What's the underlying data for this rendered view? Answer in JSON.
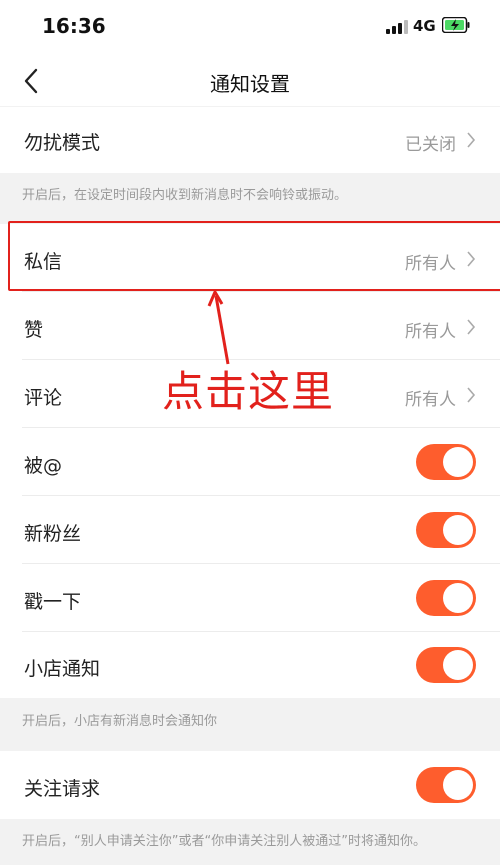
{
  "status_bar": {
    "time": "16:36",
    "network": "4G",
    "icons": [
      "signal-icon",
      "battery-charging-icon"
    ]
  },
  "nav": {
    "title": "通知设置",
    "back_icon": "back-arrow-icon"
  },
  "rows": {
    "dnd": {
      "label": "勿扰模式",
      "value": "已关闭"
    },
    "dnd_hint": "开启后，在设定时间段内收到新消息时不会响铃或振动。",
    "private_msg": {
      "label": "私信",
      "value": "所有人"
    },
    "likes": {
      "label": "赞",
      "value": "所有人"
    },
    "comments": {
      "label": "评论",
      "value": "所有人"
    },
    "mentions": {
      "label": "被@",
      "toggle": true
    },
    "new_fans": {
      "label": "新粉丝",
      "toggle": true
    },
    "poke": {
      "label": "戳一下",
      "toggle": true
    },
    "shop": {
      "label": "小店通知",
      "toggle": true
    },
    "shop_hint": "开启后，小店有新消息时会通知你",
    "follow_req": {
      "label": "关注请求",
      "toggle": true
    },
    "follow_hint": "开启后，“别人申请关注你”或者“你申请关注别人被通过”时将通知你。"
  },
  "annotation": {
    "text": "点击这里"
  },
  "colors": {
    "accent": "#fe5d2d",
    "annotation_red": "#e2211c",
    "secondary_text": "#9a9a9a",
    "background": "#f2f2f2"
  }
}
